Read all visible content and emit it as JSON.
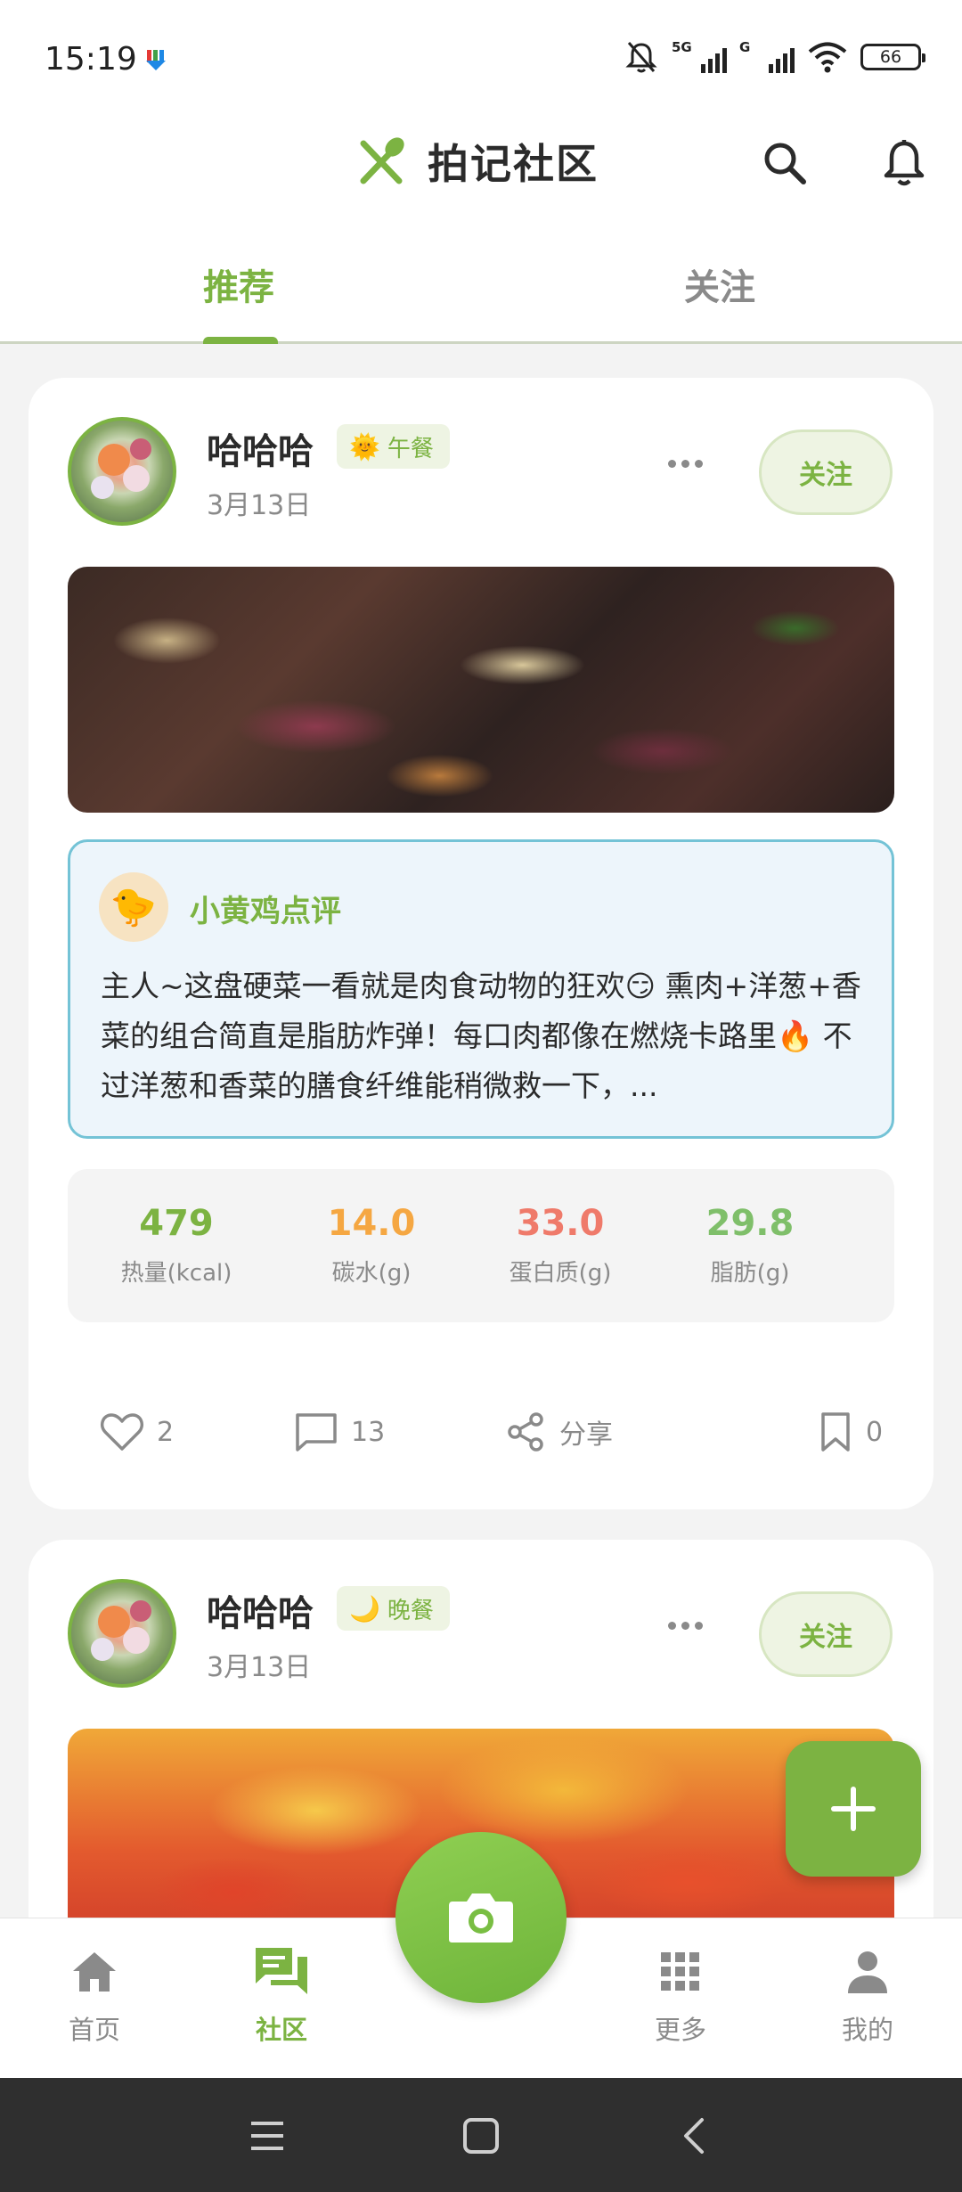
{
  "status_bar": {
    "time": "15:19",
    "network_5g": "5G",
    "network_g": "G",
    "battery": "66"
  },
  "header": {
    "title": "拍记社区"
  },
  "tabs": [
    {
      "label": "推荐"
    },
    {
      "label": "关注"
    }
  ],
  "posts": [
    {
      "user_name": "哈哈哈",
      "meal_icon": "🌞",
      "meal": "午餐",
      "date": "3月13日",
      "follow_label": "关注",
      "review_icon": "🐤",
      "review_title": "小黄鸡点评",
      "review_text": "主人~这盘硬菜一看就是肉食动物的狂欢😏 熏肉+洋葱+香菜的组合简直是脂肪炸弹！每口肉都像在燃烧卡路里🔥 不过洋葱和香菜的膳食纤维能稍微救一下，...",
      "nutrition": [
        {
          "value": "479",
          "label": "热量(kcal)",
          "color": "#7cb342"
        },
        {
          "value": "14.0",
          "label": "碳水(g)",
          "color": "#f5a742"
        },
        {
          "value": "33.0",
          "label": "蛋白质(g)",
          "color": "#ef7a6a"
        },
        {
          "value": "29.8",
          "label": "脂肪(g)",
          "color": "#7fbf6a"
        }
      ],
      "likes": "2",
      "comments": "13",
      "share_label": "分享",
      "bookmarks": "0"
    },
    {
      "user_name": "哈哈哈",
      "meal_icon": "🌙",
      "meal": "晚餐",
      "date": "3月13日",
      "follow_label": "关注"
    }
  ],
  "bottom_nav": [
    {
      "label": "首页"
    },
    {
      "label": "社区"
    },
    {
      "label": "更多"
    },
    {
      "label": "我的"
    }
  ],
  "colors": {
    "accent": "#7cb342",
    "review_border": "#74c3d6",
    "review_bg": "#edf5fb"
  }
}
